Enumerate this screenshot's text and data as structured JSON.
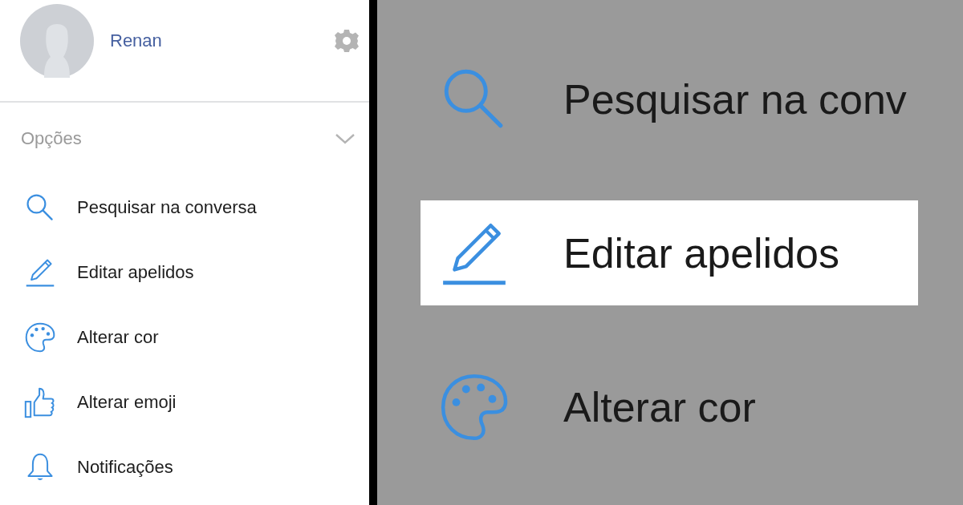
{
  "sidebar": {
    "profile": {
      "name": "Renan"
    },
    "section": {
      "title": "Opções",
      "expanded": true
    },
    "items": [
      {
        "kind": "search",
        "label": "Pesquisar na conversa"
      },
      {
        "kind": "pencil",
        "label": "Editar apelidos"
      },
      {
        "kind": "palette",
        "label": "Alterar cor"
      },
      {
        "kind": "thumbs-up",
        "label": "Alterar emoji"
      },
      {
        "kind": "bell",
        "label": "Notificações"
      }
    ]
  },
  "zoomed_view": {
    "items": [
      {
        "kind": "search",
        "label": "Pesquisar na conv",
        "selected": false
      },
      {
        "kind": "pencil",
        "label": "Editar apelidos",
        "selected": true
      },
      {
        "kind": "palette",
        "label": "Alterar cor",
        "selected": false
      }
    ]
  }
}
